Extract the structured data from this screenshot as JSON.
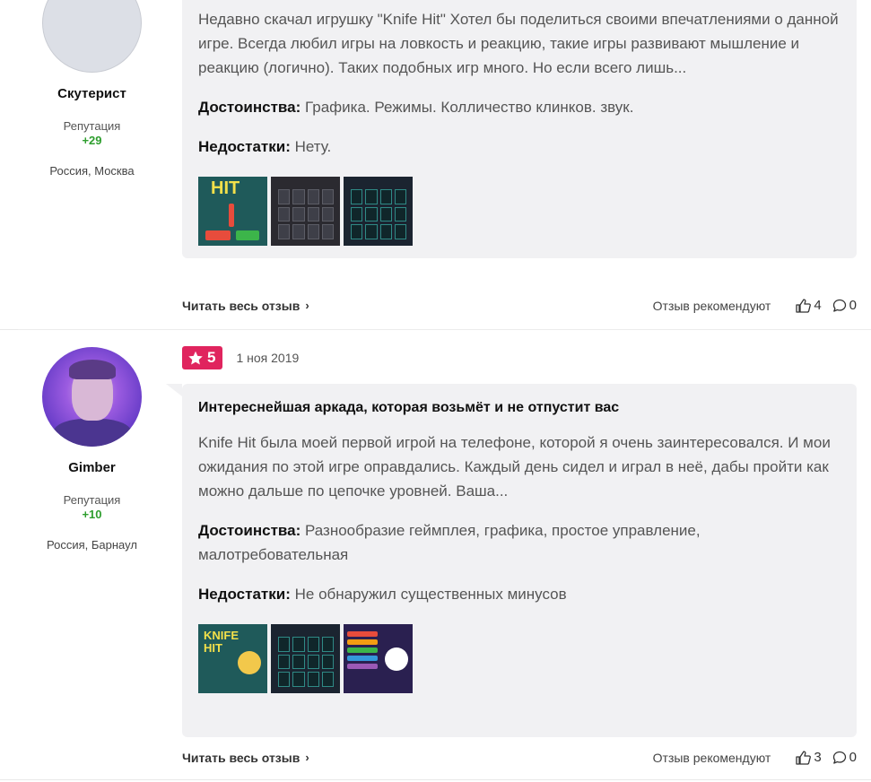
{
  "reviews": [
    {
      "author": {
        "name": "Скутерист",
        "rep_label": "Репутация",
        "rep_value": "+29",
        "location": "Россия, Москва"
      },
      "text": "Недавно скачал игрушку \"Knife Hit\" Хотел бы поделиться своими впечатлениями о данной игре. Всегда любил игры на ловкость и реакцию, такие игры развивают мышление и реакцию (логично). Таких подобных игр много. Но если всего лишь...",
      "pros_label": "Достоинства:",
      "pros": "Графика. Режимы. Колличество клинков. звук.",
      "cons_label": "Недостатки:",
      "cons": "Нету.",
      "read_more": "Читать весь отзыв",
      "recommend": "Отзыв рекомендуют",
      "likes": "4",
      "comments": "0"
    },
    {
      "author": {
        "name": "Gimber",
        "rep_label": "Репутация",
        "rep_value": "+10",
        "location": "Россия, Барнаул"
      },
      "rating": "5",
      "date": "1 ноя 2019",
      "title": "Интереснейшая аркада, которая возьмёт и не отпустит вас",
      "text": "Knife Hit была моей первой игрой на телефоне, которой я очень заинтересовался. И мои ожидания по этой игре оправдались. Каждый день сидел и играл в неё, дабы пройти как можно дальше по цепочке уровней. Ваша...",
      "pros_label": "Достоинства:",
      "pros": "Разнообразие геймплея, графика, простое управление, малотребовательная",
      "cons_label": "Недостатки:",
      "cons": "Не обнаружил существенных минусов",
      "read_more": "Читать весь отзыв",
      "recommend": "Отзыв рекомендуют",
      "likes": "3",
      "comments": "0"
    }
  ],
  "thumb_labels": {
    "hit": "HIT",
    "knife_hit": "KNIFE HIT"
  },
  "colors": {
    "rating_badge": "#e0245e",
    "reputation": "#2e9e2e",
    "bubble_bg": "#f1f1f3"
  }
}
